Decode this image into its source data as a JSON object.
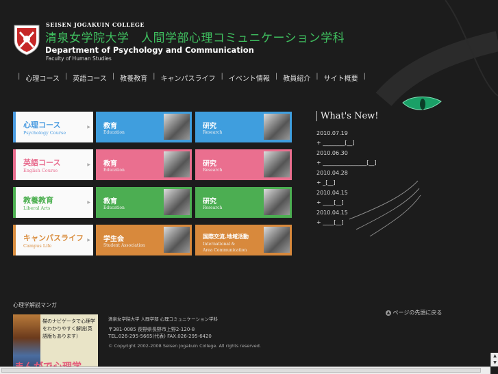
{
  "header": {
    "college": "SEISEN JOGAKUIN COLLEGE",
    "title_jp": "清泉女学院大学　人間学部心理コミュニケーション学科",
    "dept": "Department of Psychology and Communication",
    "faculty": "Faculty of Human Studies"
  },
  "nav": [
    "心理コース",
    "英語コース",
    "教養教育",
    "キャンパスライフ",
    "イベント情報",
    "教員紹介",
    "サイト概要"
  ],
  "tiles": [
    [
      {
        "jp": "心理コース",
        "en": "Psychology Course",
        "color": "#4a9be0"
      },
      {
        "jp": "教育",
        "en": "Education",
        "color": "#3f9ede"
      },
      {
        "jp": "研究",
        "en": "Research",
        "color": "#3f9ede"
      }
    ],
    [
      {
        "jp": "英語コース",
        "en": "English Course",
        "color": "#e86c8e"
      },
      {
        "jp": "教育",
        "en": "Education",
        "color": "#ea6f8f"
      },
      {
        "jp": "研究",
        "en": "Research",
        "color": "#ea6f8f"
      }
    ],
    [
      {
        "jp": "教養教育",
        "en": "Liberal Arts",
        "color": "#4caf50"
      },
      {
        "jp": "教育",
        "en": "Education",
        "color": "#4cae52"
      },
      {
        "jp": "研究",
        "en": "Research",
        "color": "#4cae52"
      }
    ],
    [
      {
        "jp": "キャンパスライフ",
        "en": "Campus Life",
        "color": "#d98d3e"
      },
      {
        "jp": "学生会",
        "en": "Student Association",
        "color": "#d8893c"
      },
      {
        "jp": "国際交流.地域活動",
        "en": "International &",
        "en2": "Area Communication",
        "color": "#d8893c"
      }
    ]
  ],
  "news": {
    "heading": "What's New!",
    "items": [
      {
        "date": "2010.07.19",
        "link": "+ ________[__]"
      },
      {
        "date": "2010.06.30",
        "link": "+ ________________[__]"
      },
      {
        "date": "2010.04.28",
        "link": "+ _[__]"
      },
      {
        "date": "2010.04.15",
        "link": "+ ____[__]"
      },
      {
        "date": "2010.04.15",
        "link": "+ ____[__]"
      }
    ]
  },
  "footer": {
    "top_link": "ページの先頭に戻る",
    "left_heading": "心理学解説マンガ",
    "manga_text": "猫のナビゲータで心理学をわかりやすく解説(英語版もあります)",
    "manga_title": "まんがで心理学",
    "address_line": "清泉女学院大学 人間学部 心理コミュニケーション学科",
    "postal": "〒381-0085 長野県長野市上野2-120-8",
    "tel": "TEL.026-295-5665(代表) FAX.026-295-6420",
    "copyright": "© Copyright 2002-2008 Seisen Jogakuin College. All rights reserved."
  }
}
